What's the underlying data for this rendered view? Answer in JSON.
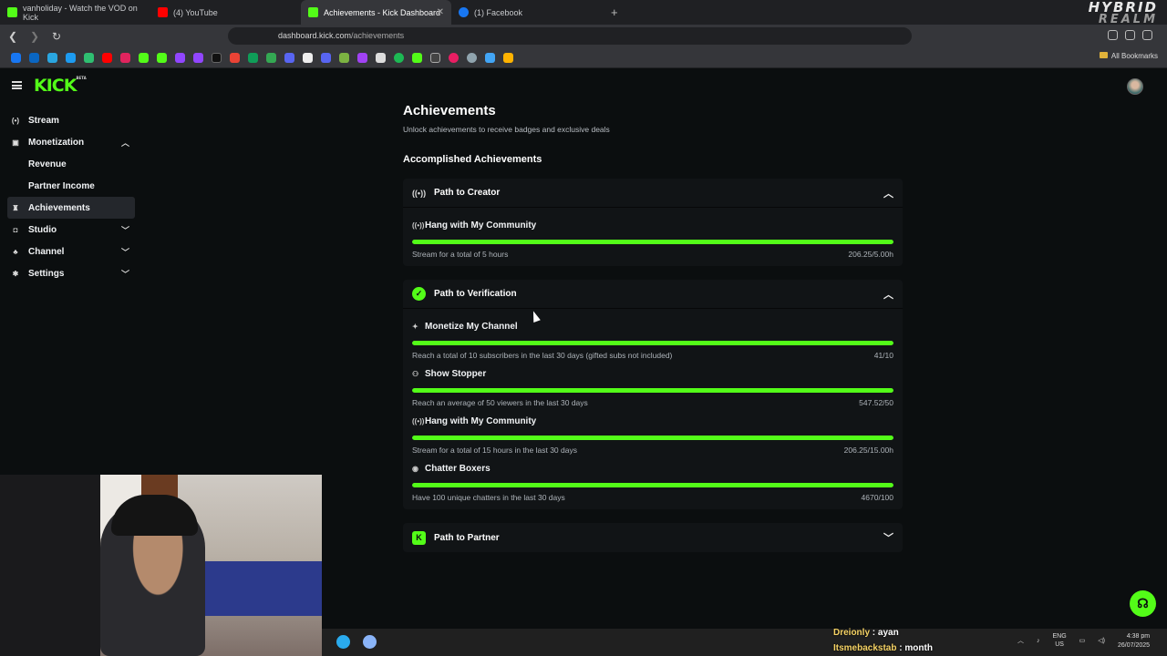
{
  "browser": {
    "tabs": [
      {
        "title": "vanholiday - Watch the VOD on Kick",
        "favicon_color": "#53fc18"
      },
      {
        "title": "(4) YouTube",
        "favicon_color": "#ff0000"
      },
      {
        "title": "Achievements - Kick Dashboard",
        "favicon_color": "#53fc18"
      },
      {
        "title": "(1) Facebook",
        "favicon_color": "#1877f2"
      }
    ],
    "url_host": "dashboard.kick.com",
    "url_path": "/achievements",
    "all_bookmarks": "All Bookmarks",
    "overlay_brand": "HYBRID",
    "overlay_brand_sub": "REALM"
  },
  "app": {
    "logo": "KICK",
    "logo_badge": "BETA"
  },
  "sidebar": {
    "items": [
      {
        "label": "Stream",
        "icon": "broadcast-icon"
      },
      {
        "label": "Monetization",
        "icon": "dollar-icon"
      },
      {
        "label": "Revenue"
      },
      {
        "label": "Partner Income"
      },
      {
        "label": "Achievements",
        "icon": "trophy-icon"
      },
      {
        "label": "Studio",
        "icon": "studio-icon"
      },
      {
        "label": "Channel",
        "icon": "channel-icon"
      },
      {
        "label": "Settings",
        "icon": "gear-icon"
      }
    ]
  },
  "page": {
    "title": "Achievements",
    "subtitle": "Unlock achievements to receive badges and exclusive deals",
    "section_title": "Accomplished Achievements"
  },
  "paths": {
    "creator": {
      "title": "Path to Creator",
      "achievements": [
        {
          "name": "Hang with My Community",
          "description": "Stream for a total of 5 hours",
          "progress_text": "206.25/5.00h",
          "progress": 1.0
        }
      ]
    },
    "verification": {
      "title": "Path to Verification",
      "achievements": [
        {
          "name": "Monetize My Channel",
          "description": "Reach a total of 10 subscribers in the last 30 days (gifted subs not included)",
          "progress_text": "41/10",
          "progress": 1.0
        },
        {
          "name": "Show Stopper",
          "description": "Reach an average of 50 viewers in the last 30 days",
          "progress_text": "547.52/50",
          "progress": 1.0
        },
        {
          "name": "Hang with My Community",
          "description": "Stream for a total of 15 hours in the last 30 days",
          "progress_text": "206.25/15.00h",
          "progress": 1.0
        },
        {
          "name": "Chatter Boxers",
          "description": "Have 100 unique chatters in the last 30 days",
          "progress_text": "4670/100",
          "progress": 1.0
        }
      ]
    },
    "partner": {
      "title": "Path to Partner"
    }
  },
  "overlay_chat": [
    {
      "user": "Dreionly",
      "message": "ayan"
    },
    {
      "user": "Itsmebackstab",
      "message": "month"
    }
  ],
  "taskbar": {
    "lang": "ENG",
    "region": "US",
    "time": "4:38 pm",
    "date": "26/07/2025"
  },
  "colors": {
    "accent": "#53fc18",
    "background": "#0b0e0f",
    "card": "#111416"
  }
}
